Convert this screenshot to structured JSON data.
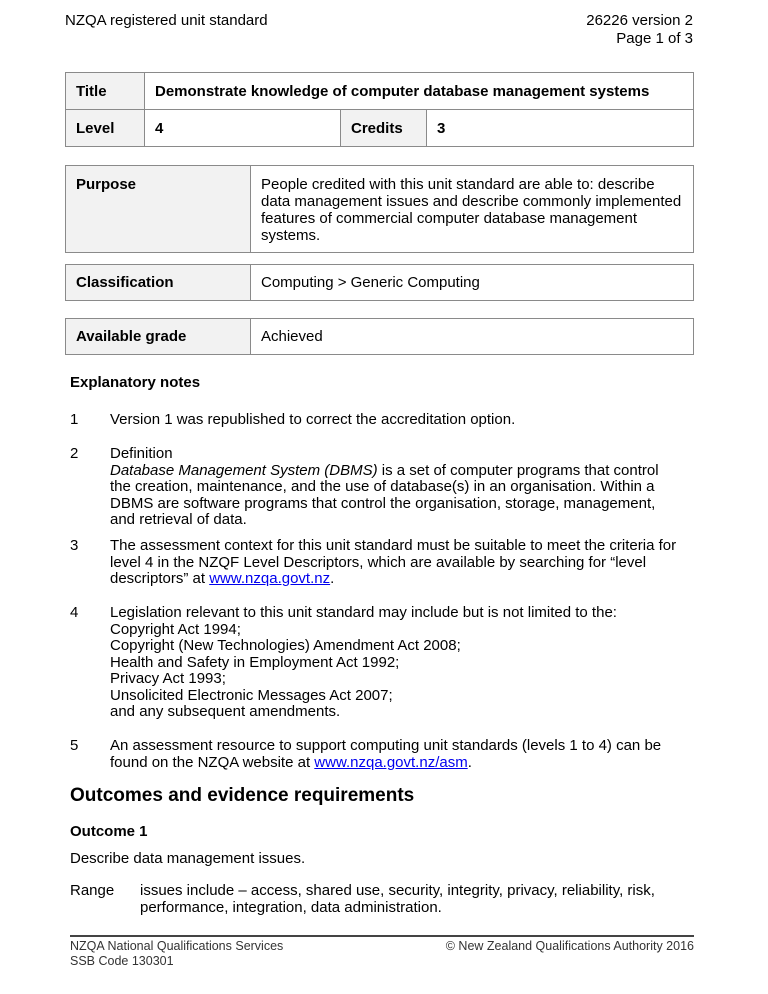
{
  "header": {
    "left": "NZQA registered unit standard",
    "right_line1": "26226 version 2",
    "right_line2": "Page 1 of 3"
  },
  "info_table": {
    "title_label": "Title",
    "title_value": "Demonstrate knowledge of computer database management systems",
    "level_label": "Level",
    "level_value": "4",
    "credits_label": "Credits",
    "credits_value": "3"
  },
  "purpose": {
    "label": "Purpose",
    "lines": [
      "People credited with this unit standard are able to: describe",
      "data management issues and describe commonly implemented",
      "features of commercial computer database management",
      "systems."
    ]
  },
  "classification": {
    "label": "Classification",
    "value": "Computing > Generic Computing"
  },
  "grade": {
    "label": "Available grade",
    "value": "Achieved"
  },
  "explanatory_notes": {
    "heading": "Explanatory notes",
    "n1": {
      "num": "1",
      "text": "Version 1 was republished to correct the accreditation option."
    },
    "n2": {
      "num": "2",
      "line1": "Definition",
      "term": "Database Management System (DBMS)",
      "line2_rest": " is a set of computer programs that control",
      "line3": "the creation, maintenance, and the use of database(s) in an organisation.  Within a",
      "line4": "DBMS are software programs that control the organisation, storage, management,",
      "line5": "and retrieval of data."
    },
    "n3": {
      "num": "3",
      "line1": "The assessment context for this unit standard must be suitable to meet the criteria for",
      "line2": "level 4 in the NZQF Level Descriptors, which are available by searching for “level",
      "line3_pre": "descriptors” at ",
      "link": "www.nzqa.govt.nz",
      "line3_post": "."
    },
    "n4": {
      "num": "4",
      "lines": [
        "Legislation relevant to this unit standard may include but is not limited to the:",
        "Copyright Act 1994;",
        "Copyright (New Technologies) Amendment Act 2008;",
        "Health and Safety in Employment Act 1992;",
        "Privacy Act 1993;",
        "Unsolicited Electronic Messages Act 2007;",
        "and any subsequent amendments."
      ]
    },
    "n5": {
      "num": "5",
      "line1": "An assessment resource to support computing unit standards (levels 1 to 4) can be",
      "line2_pre": "found on the NZQA website at ",
      "link": "www.nzqa.govt.nz/asm",
      "line2_post": "."
    }
  },
  "outcomes": {
    "heading": "Outcomes and evidence requirements",
    "outcome1_heading": "Outcome 1",
    "outcome1_text": "Describe data management issues.",
    "range_label": "Range",
    "range_line1": "issues include – access, shared use, security, integrity, privacy, reliability, risk,",
    "range_line2": "performance, integration, data administration."
  },
  "footer": {
    "left_line1": "NZQA National Qualifications Services",
    "left_line2": "SSB Code 130301",
    "right": "© New Zealand Qualifications Authority 2016"
  }
}
